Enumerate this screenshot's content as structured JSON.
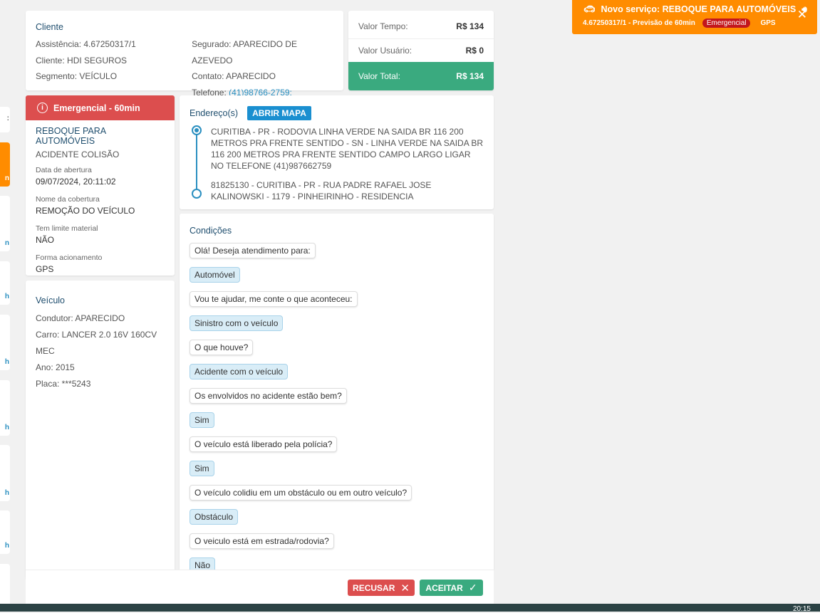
{
  "notification": {
    "title": "Novo serviço: REBOQUE PARA AUTOMÓVEIS",
    "subtitle": "4.67250317/1 - Previsão de 60min",
    "badge": "Emergencial",
    "tag": "GPS",
    "color": "#ff8c00",
    "icons": [
      "car-icon",
      "speaker-icon",
      "close-icon"
    ]
  },
  "side_strip": [
    ":",
    "n",
    "n",
    "h",
    "h",
    "h",
    "h",
    "h",
    ""
  ],
  "client": {
    "title": "Cliente",
    "assistencia": "Assistência: 4.67250317/1",
    "cliente": "Cliente: HDI SEGUROS",
    "segmento": "Segmento: VEÍCULO",
    "segurado": "Segurado: APARECIDO DE AZEVEDO",
    "contato": "Contato: APARECIDO",
    "telefone_label": "Telefone: ",
    "telefone": "(41)98766-2759;"
  },
  "values": {
    "tempo_label": "Valor Tempo:",
    "tempo": "R$ 134",
    "usuario_label": "Valor Usuário:",
    "usuario": "R$ 0",
    "total_label": "Valor Total:",
    "total": "R$ 134",
    "total_color": "#3aaa7f"
  },
  "service": {
    "header": "Emergencial - 60min",
    "header_color": "#dc4e4e",
    "name": "REBOQUE PARA AUTOMÓVEIS",
    "type": "ACIDENTE COLISÃO",
    "abertura_label": "Data de abertura",
    "abertura": "09/07/2024, 20:11:02",
    "cobertura_label": "Nome da cobertura",
    "cobertura": "REMOÇÃO DO VEÍCULO",
    "limite_label": "Tem limite material",
    "limite": "NÃO",
    "forma_label": "Forma acionamento",
    "forma": "GPS"
  },
  "vehicle": {
    "title": "Veículo",
    "condutor": "Condutor: APARECIDO",
    "carro": "Carro: LANCER 2.0 16V 160CV MEC",
    "ano": "Ano: 2015",
    "placa": "Placa: ***5243"
  },
  "address": {
    "title": "Endereço(s)",
    "map_button": "ABRIR MAPA",
    "origin": "CURITIBA - PR - RODOVIA LINHA VERDE NA SAIDA BR 116 200 METROS PRA FRENTE SENTIDO - SN - LINHA VERDE NA SAIDA BR 116 200 METROS PRA FRENTE SENTIDO CAMPO LARGO LIGAR NO TELEFONE (41)987662759",
    "destination": "81825130 - CURITIBA - PR - RUA PADRE RAFAEL JOSE KALINOWSKI - 1179 - PINHEIRINHO - RESIDENCIA"
  },
  "conditions": {
    "title": "Condições",
    "messages": [
      {
        "type": "q",
        "text": "Olá! Deseja atendimento para:"
      },
      {
        "type": "a",
        "text": "Automóvel"
      },
      {
        "type": "q",
        "text": "Vou te ajudar, me conte o que aconteceu:"
      },
      {
        "type": "a",
        "text": "Sinistro com o veículo"
      },
      {
        "type": "q",
        "text": "O que houve?"
      },
      {
        "type": "a",
        "text": "Acidente com o veículo"
      },
      {
        "type": "q",
        "text": "Os envolvidos no acidente estão bem?"
      },
      {
        "type": "a",
        "text": "Sim"
      },
      {
        "type": "q",
        "text": "O veículo está liberado pela polícia?"
      },
      {
        "type": "a",
        "text": "Sim"
      },
      {
        "type": "q",
        "text": "O veículo colidiu em um obstáculo ou em outro veículo?"
      },
      {
        "type": "a",
        "text": "Obstáculo"
      },
      {
        "type": "q",
        "text": "O veiculo está em estrada/rodovia?"
      },
      {
        "type": "a",
        "text": "Não"
      }
    ]
  },
  "footer": {
    "refuse": "RECUSAR",
    "accept": "ACEITAR"
  },
  "taskbar": {
    "time": "20:15"
  }
}
